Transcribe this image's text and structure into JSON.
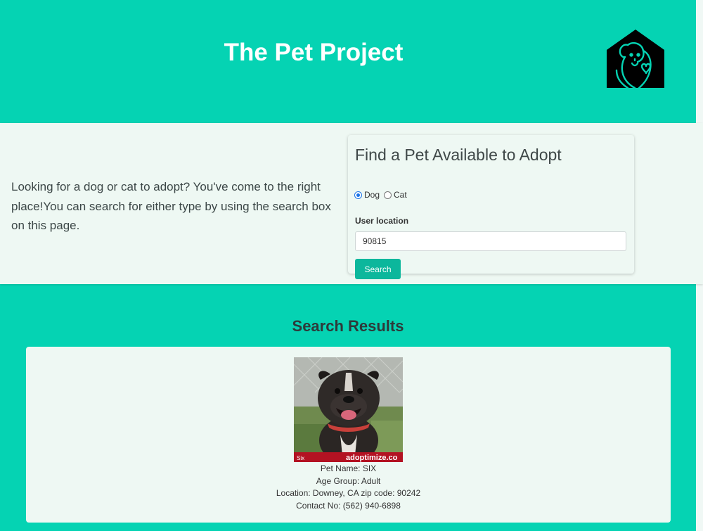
{
  "header": {
    "title": "The Pet Project",
    "logo_icon": "pet-house-logo-icon"
  },
  "intro": {
    "text": "Looking for a dog or cat to adopt? You've come to the right place!You can search for either type by using the search box on this page."
  },
  "search_form": {
    "heading": "Find a Pet Available to Adopt",
    "pet_type_options": [
      {
        "label": "Dog",
        "checked": true
      },
      {
        "label": "Cat",
        "checked": false
      }
    ],
    "location_label": "User location",
    "location_value": "90815",
    "search_button_label": "Search"
  },
  "results": {
    "heading": "Search Results",
    "items": [
      {
        "photo_caption_left": "Six",
        "photo_watermark": "adoptimize.co",
        "pet_name": "Pet Name: SIX",
        "age_group": "Age Group: Adult",
        "location": "Location: Downey, CA zip code: 90242",
        "contact": "Contact No: (562) 940-6898"
      }
    ]
  },
  "colors": {
    "brand_teal": "#05d3b3",
    "button_teal": "#0cb79c",
    "panel_bg": "#eef8f3"
  }
}
